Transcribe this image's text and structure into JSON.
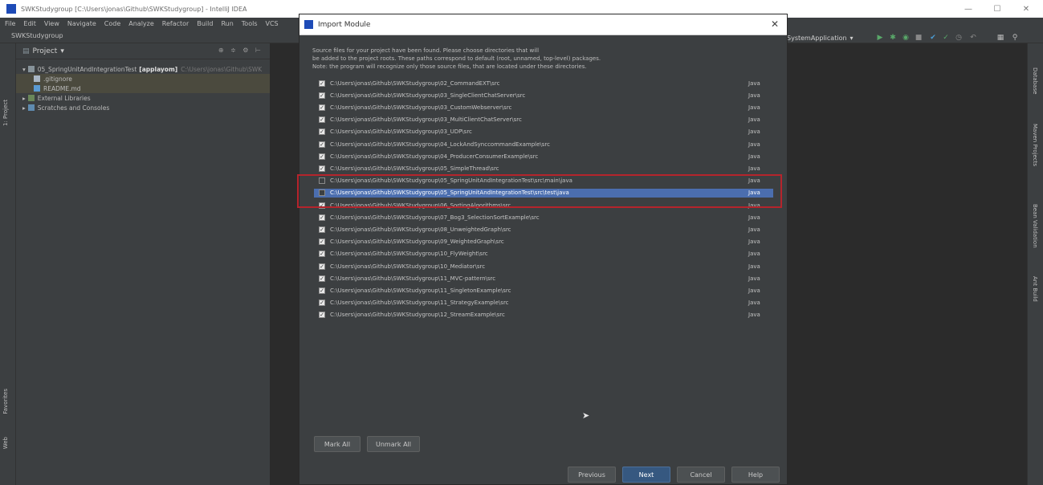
{
  "window": {
    "title": "SWKStudygroup [C:\\Users\\jonas\\Github\\SWKStudygroup] - IntelliJ IDEA"
  },
  "menu": [
    "File",
    "Edit",
    "View",
    "Navigate",
    "Code",
    "Analyze",
    "Refactor",
    "Build",
    "Run",
    "Tools",
    "VCS"
  ],
  "nav": {
    "project": "SWKStudygroup"
  },
  "run_config": "SystemApplication",
  "left_tabs": [
    "1: Project",
    "Favorites",
    "Web"
  ],
  "right_tabs": [
    "Database",
    "Maven Projects",
    "Bean Validation",
    "Ant Build"
  ],
  "project_panel": {
    "title": "Project",
    "tree": [
      {
        "label": "05_SpringUnitAndIntegrationTest",
        "bold": "[applayom]",
        "path": "C:\\Users\\jonas\\Github\\SWK"
      },
      {
        "label": ".gitignore"
      },
      {
        "label": "README.md"
      },
      {
        "label": "External Libraries"
      },
      {
        "label": "Scratches and Consoles"
      }
    ]
  },
  "dialog": {
    "title": "Import Module",
    "description": [
      "Source files for your project have been found. Please choose directories that will",
      "be added to the project roots. These paths correspond to default (root, unnamed, top-level) packages.",
      "Note: the program will recognize only those source files, that are located under these directories."
    ],
    "rows": [
      {
        "path": "C:\\Users\\jonas\\Github\\SWKStudygroup\\02_CommandEXT\\src",
        "lang": "Java",
        "checked": true
      },
      {
        "path": "C:\\Users\\jonas\\Github\\SWKStudygroup\\03_SingleClientChatServer\\src",
        "lang": "Java",
        "checked": true
      },
      {
        "path": "C:\\Users\\jonas\\Github\\SWKStudygroup\\03_CustomWebserver\\src",
        "lang": "Java",
        "checked": true
      },
      {
        "path": "C:\\Users\\jonas\\Github\\SWKStudygroup\\03_MultiClientChatServer\\src",
        "lang": "Java",
        "checked": true
      },
      {
        "path": "C:\\Users\\jonas\\Github\\SWKStudygroup\\03_UDP\\src",
        "lang": "Java",
        "checked": true
      },
      {
        "path": "C:\\Users\\jonas\\Github\\SWKStudygroup\\04_LockAndSynccommandExample\\src",
        "lang": "Java",
        "checked": true
      },
      {
        "path": "C:\\Users\\jonas\\Github\\SWKStudygroup\\04_ProducerConsumerExample\\src",
        "lang": "Java",
        "checked": true
      },
      {
        "path": "C:\\Users\\jonas\\Github\\SWKStudygroup\\05_SimpleThread\\src",
        "lang": "Java",
        "checked": true
      },
      {
        "path": "C:\\Users\\jonas\\Github\\SWKStudygroup\\05_SpringUnitAndIntegrationTest\\src\\main\\java",
        "lang": "Java",
        "checked": false
      },
      {
        "path": "C:\\Users\\jonas\\Github\\SWKStudygroup\\05_SpringUnitAndIntegrationTest\\src\\test\\java",
        "lang": "Java",
        "checked": false,
        "selected": true
      },
      {
        "path": "C:\\Users\\jonas\\Github\\SWKStudygroup\\06_SortingAlgorithms\\src",
        "lang": "Java",
        "checked": true
      },
      {
        "path": "C:\\Users\\jonas\\Github\\SWKStudygroup\\07_Bog3_SelectionSortExample\\src",
        "lang": "Java",
        "checked": true
      },
      {
        "path": "C:\\Users\\jonas\\Github\\SWKStudygroup\\08_UnweightedGraph\\src",
        "lang": "Java",
        "checked": true
      },
      {
        "path": "C:\\Users\\jonas\\Github\\SWKStudygroup\\09_WeightedGraph\\src",
        "lang": "Java",
        "checked": true
      },
      {
        "path": "C:\\Users\\jonas\\Github\\SWKStudygroup\\10_FlyWeight\\src",
        "lang": "Java",
        "checked": true
      },
      {
        "path": "C:\\Users\\jonas\\Github\\SWKStudygroup\\10_Mediator\\src",
        "lang": "Java",
        "checked": true
      },
      {
        "path": "C:\\Users\\jonas\\Github\\SWKStudygroup\\11_MVC-pattern\\src",
        "lang": "Java",
        "checked": true
      },
      {
        "path": "C:\\Users\\jonas\\Github\\SWKStudygroup\\11_SingletonExample\\src",
        "lang": "Java",
        "checked": true
      },
      {
        "path": "C:\\Users\\jonas\\Github\\SWKStudygroup\\11_StrategyExample\\src",
        "lang": "Java",
        "checked": true
      },
      {
        "path": "C:\\Users\\jonas\\Github\\SWKStudygroup\\12_StreamExample\\src",
        "lang": "Java",
        "checked": true
      }
    ],
    "buttons": {
      "mark_all": "Mark All",
      "unmark_all": "Unmark All",
      "previous": "Previous",
      "next": "Next",
      "cancel": "Cancel",
      "help": "Help"
    }
  },
  "colors": {
    "accent": "#4b6eaf",
    "highlight_box": "#b5242c",
    "primary_button": "#365880"
  }
}
